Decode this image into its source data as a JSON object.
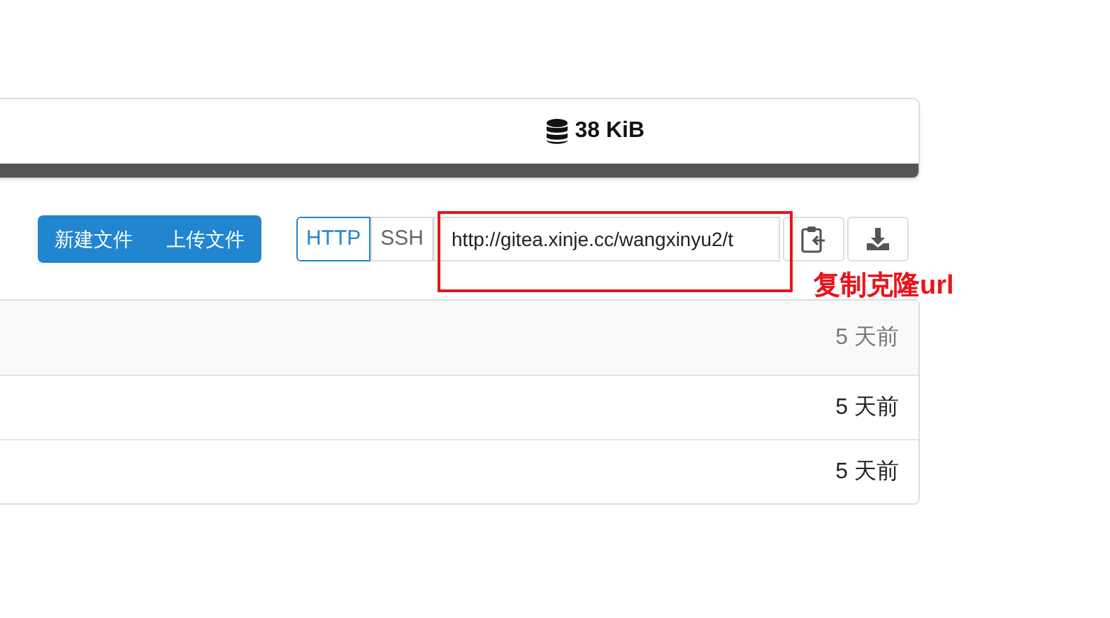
{
  "repo_stats": {
    "size": "38 KiB"
  },
  "file_buttons": [
    "新建文件",
    "上传文件"
  ],
  "clone": {
    "protocols": [
      {
        "label": "HTTP",
        "selected": true
      },
      {
        "label": "SSH",
        "selected": false
      }
    ],
    "url": "http://gitea.xinje.cc/wangxinyu2/t"
  },
  "file_rows": [
    {
      "time": "5 天前",
      "kind": "commit"
    },
    {
      "time": "5 天前",
      "kind": "file"
    },
    {
      "time": "5 天前",
      "kind": "file"
    }
  ],
  "annotation": {
    "label": "复制克隆url"
  }
}
